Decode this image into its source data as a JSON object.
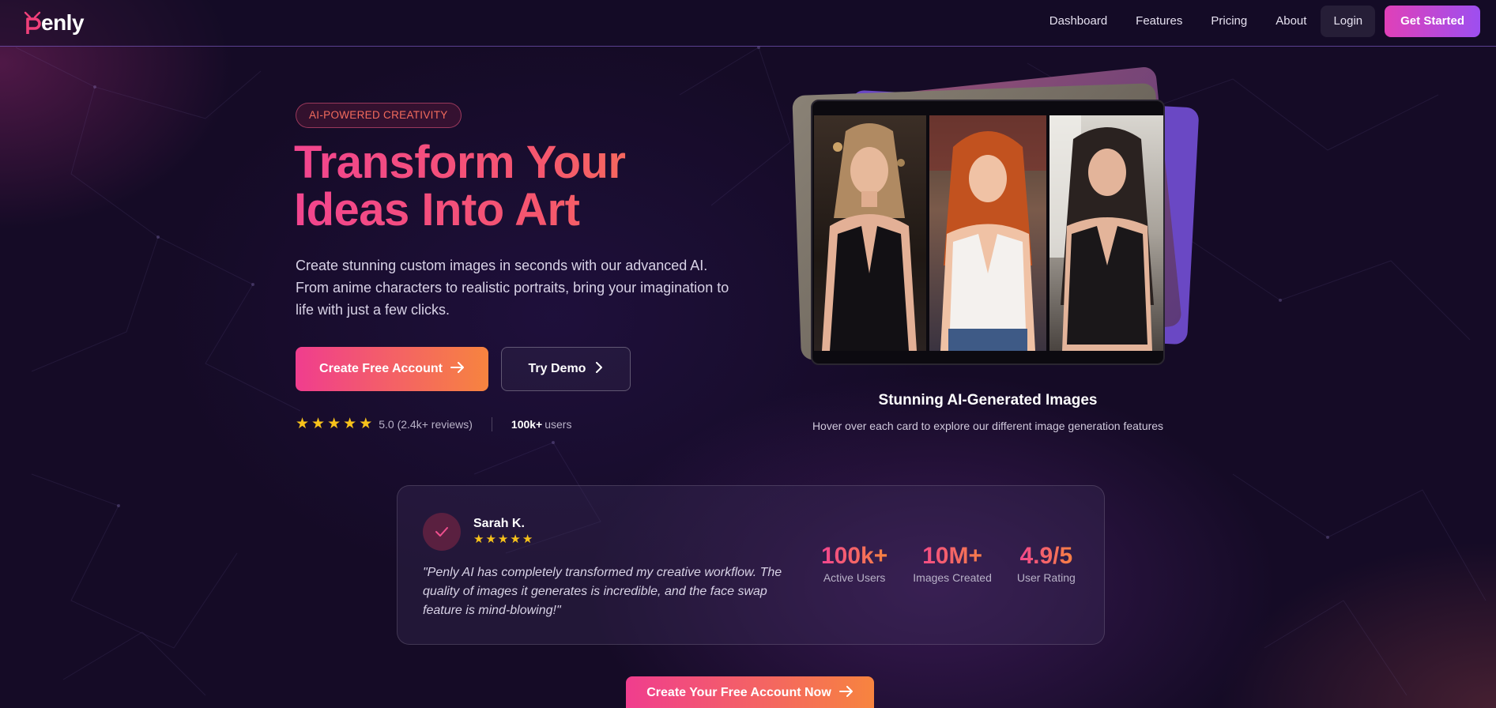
{
  "brand": {
    "name": "enly",
    "logo_letter": "P"
  },
  "nav": {
    "links": [
      "Dashboard",
      "Features",
      "Pricing",
      "About"
    ],
    "login": "Login",
    "cta": "Get Started"
  },
  "hero": {
    "badge": "AI-POWERED CREATIVITY",
    "title_line1": "Transform Your",
    "title_line2": "Ideas Into Art",
    "description": "Create stunning custom images in seconds with our advanced AI. From anime characters to realistic portraits, bring your imagination to life with just a few clicks.",
    "primary_button": "Create Free Account",
    "secondary_button": "Try Demo",
    "rating_text": "5.0 (2.4k+ reviews)",
    "rating_stars": 5,
    "users_number": "100k+",
    "users_label": "users"
  },
  "gallery": {
    "title": "Stunning AI-Generated Images",
    "subtitle": "Hover over each card to explore our different image generation features"
  },
  "testimonial": {
    "name": "Sarah K.",
    "stars": 5,
    "quote": "\"Penly AI has completely transformed my creative workflow. The quality of images it generates is incredible, and the face swap feature is mind-blowing!\"",
    "stats": [
      {
        "value": "100k+",
        "label": "Active Users"
      },
      {
        "value": "10M+",
        "label": "Images Created"
      },
      {
        "value": "4.9/5",
        "label": "User Rating"
      }
    ]
  },
  "bottom_cta": "Create Your Free Account Now",
  "colors": {
    "background": "#150b26",
    "accent_pink": "#f03d8e",
    "accent_orange": "#f7843f",
    "accent_purple": "#9d4ff0",
    "star": "#f7c21b"
  },
  "icons": {
    "arrow": "arrow-right-icon",
    "chevron": "chevron-right-icon",
    "check": "check-icon",
    "star": "star-icon"
  }
}
